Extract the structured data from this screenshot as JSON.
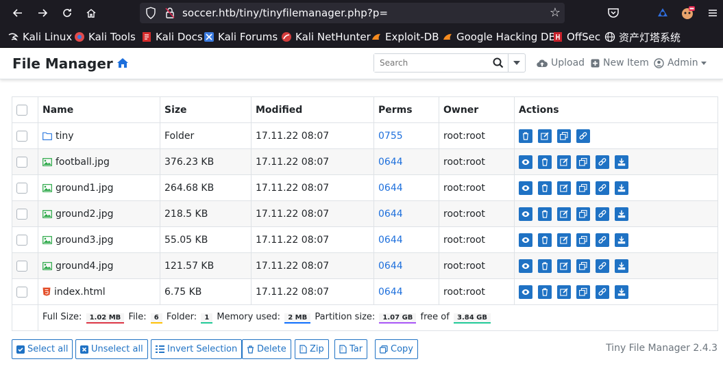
{
  "browser": {
    "url": "soccer.htb/tiny/tinyfilemanager.php?p=",
    "bookmarks": [
      {
        "label": "Kali Linux",
        "color": "#4a90d9"
      },
      {
        "label": "Kali Tools",
        "color": "#e24b4b"
      },
      {
        "label": "Kali Docs",
        "color": "#d62b2b"
      },
      {
        "label": "Kali Forums",
        "color": "#3b7be0"
      },
      {
        "label": "Kali NetHunter",
        "color": "#d43c3c"
      },
      {
        "label": "Exploit-DB",
        "color": "#f58a1f"
      },
      {
        "label": "Google Hacking DB",
        "color": "#f58a1f"
      },
      {
        "label": "OffSec",
        "color": "#c8202a"
      },
      {
        "label": "资产灯塔系统",
        "color": "#fbfbfe"
      }
    ]
  },
  "app": {
    "title": "File Manager",
    "search_placeholder": "Search",
    "nav": {
      "upload": "Upload",
      "new_item": "New Item",
      "admin": "Admin"
    }
  },
  "table": {
    "headers": {
      "name": "Name",
      "size": "Size",
      "modified": "Modified",
      "perms": "Perms",
      "owner": "Owner",
      "actions": "Actions"
    },
    "rows": [
      {
        "name": "tiny",
        "type": "folder",
        "size": "Folder",
        "modified": "17.11.22 08:07",
        "perms": "0755",
        "owner": "root:root"
      },
      {
        "name": "football.jpg",
        "type": "image",
        "size": "376.23 KB",
        "modified": "17.11.22 08:07",
        "perms": "0644",
        "owner": "root:root"
      },
      {
        "name": "ground1.jpg",
        "type": "image",
        "size": "264.68 KB",
        "modified": "17.11.22 08:07",
        "perms": "0644",
        "owner": "root:root"
      },
      {
        "name": "ground2.jpg",
        "type": "image",
        "size": "218.5 KB",
        "modified": "17.11.22 08:07",
        "perms": "0644",
        "owner": "root:root"
      },
      {
        "name": "ground3.jpg",
        "type": "image",
        "size": "55.05 KB",
        "modified": "17.11.22 08:07",
        "perms": "0644",
        "owner": "root:root"
      },
      {
        "name": "ground4.jpg",
        "type": "image",
        "size": "121.57 KB",
        "modified": "17.11.22 08:07",
        "perms": "0644",
        "owner": "root:root"
      },
      {
        "name": "index.html",
        "type": "html",
        "size": "6.75 KB",
        "modified": "17.11.22 08:07",
        "perms": "0644",
        "owner": "root:root"
      }
    ]
  },
  "summary": {
    "full_size_label": "Full Size:",
    "full_size": "1.02 MB",
    "file_label": "File:",
    "file_count": "6",
    "folder_label": "Folder:",
    "folder_count": "1",
    "memory_label": "Memory used:",
    "memory": "2 MB",
    "partition_label": "Partition size:",
    "partition": "1.07 GB",
    "free_label": "free of",
    "free": "3.84 GB"
  },
  "buttons": {
    "select_all": "Select all",
    "unselect_all": "Unselect all",
    "invert": "Invert Selection",
    "delete": "Delete",
    "zip": "Zip",
    "tar": "Tar",
    "copy": "Copy"
  },
  "version": "Tiny File Manager 2.4.3",
  "colors": {
    "accent": "#1f72c4",
    "perm_link": "#1d6fdc",
    "browser_bg": "#1c1b22"
  }
}
